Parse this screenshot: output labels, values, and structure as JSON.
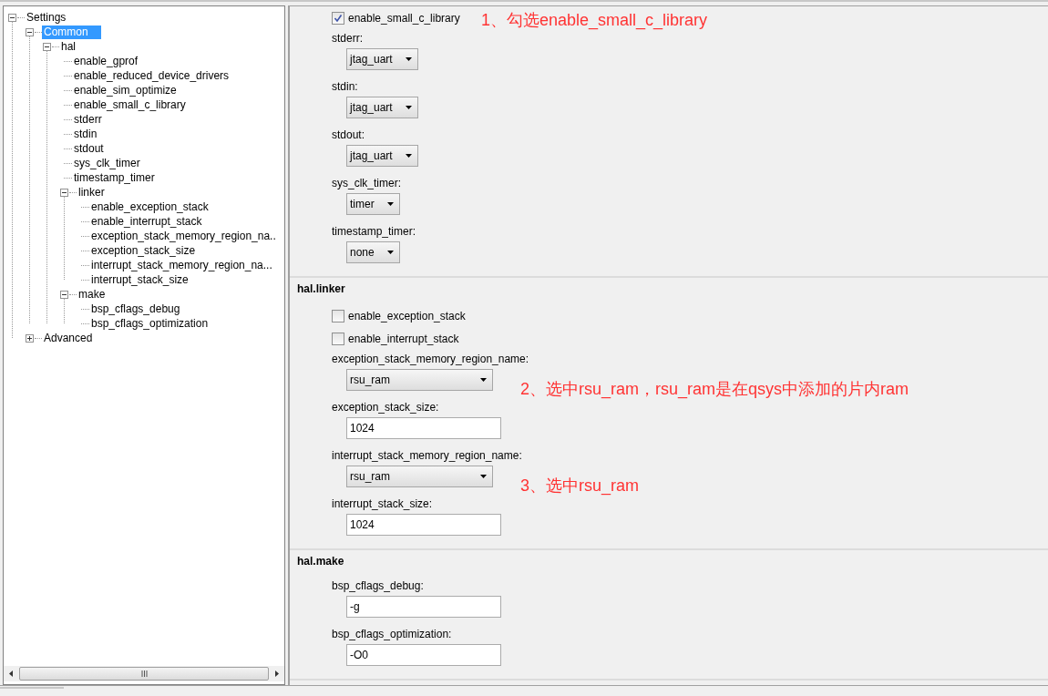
{
  "tree": [
    {
      "label": "Settings",
      "expanded": true,
      "selected": false,
      "children": [
        {
          "label": "Common",
          "expanded": true,
          "selected": true,
          "children": [
            {
              "label": "hal",
              "expanded": true,
              "selected": false,
              "children": [
                {
                  "label": "enable_gprof",
                  "selected": false
                },
                {
                  "label": "enable_reduced_device_drivers",
                  "selected": false
                },
                {
                  "label": "enable_sim_optimize",
                  "selected": false
                },
                {
                  "label": "enable_small_c_library",
                  "selected": false
                },
                {
                  "label": "stderr",
                  "selected": false
                },
                {
                  "label": "stdin",
                  "selected": false
                },
                {
                  "label": "stdout",
                  "selected": false
                },
                {
                  "label": "sys_clk_timer",
                  "selected": false
                },
                {
                  "label": "timestamp_timer",
                  "selected": false
                },
                {
                  "label": "linker",
                  "expanded": true,
                  "selected": false,
                  "children": [
                    {
                      "label": "enable_exception_stack",
                      "selected": false
                    },
                    {
                      "label": "enable_interrupt_stack",
                      "selected": false
                    },
                    {
                      "label": "exception_stack_memory_region_na..",
                      "selected": false
                    },
                    {
                      "label": "exception_stack_size",
                      "selected": false
                    },
                    {
                      "label": "interrupt_stack_memory_region_na...",
                      "selected": false
                    },
                    {
                      "label": "interrupt_stack_size",
                      "selected": false
                    }
                  ]
                },
                {
                  "label": "make",
                  "expanded": true,
                  "selected": false,
                  "children": [
                    {
                      "label": "bsp_cflags_debug",
                      "selected": false
                    },
                    {
                      "label": "bsp_cflags_optimization",
                      "selected": false
                    }
                  ]
                }
              ]
            }
          ]
        },
        {
          "label": "Advanced",
          "expanded": false,
          "selected": false
        }
      ]
    }
  ],
  "sections": [
    {
      "fields": [
        {
          "kind": "checkbox",
          "label": "enable_small_c_library",
          "checked": true,
          "note": "1、勾选enable_small_c_library"
        },
        {
          "kind": "select",
          "label": "stderr:",
          "value": "jtag_uart"
        },
        {
          "kind": "select",
          "label": "stdin:",
          "value": "jtag_uart"
        },
        {
          "kind": "select",
          "label": "stdout:",
          "value": "jtag_uart"
        },
        {
          "kind": "select",
          "label": "sys_clk_timer:",
          "value": "timer"
        },
        {
          "kind": "select",
          "label": "timestamp_timer:",
          "value": "none"
        }
      ]
    },
    {
      "title": "hal.linker",
      "fields": [
        {
          "kind": "checkbox",
          "label": "enable_exception_stack",
          "checked": false
        },
        {
          "kind": "checkbox",
          "label": "enable_interrupt_stack",
          "checked": false
        },
        {
          "kind": "select",
          "label": "exception_stack_memory_region_name:",
          "value": "rsu_ram",
          "note": "2、选中rsu_ram，rsu_ram是在qsys中添加的片内ram"
        },
        {
          "kind": "text",
          "label": "exception_stack_size:",
          "value": "1024"
        },
        {
          "kind": "select",
          "label": "interrupt_stack_memory_region_name:",
          "value": "rsu_ram",
          "note": "3、选中rsu_ram"
        },
        {
          "kind": "text",
          "label": "interrupt_stack_size:",
          "value": "1024"
        }
      ]
    },
    {
      "title": "hal.make",
      "fields": [
        {
          "kind": "text",
          "label": "bsp_cflags_debug:",
          "value": "-g"
        },
        {
          "kind": "text",
          "label": "bsp_cflags_optimization:",
          "value": "-O0"
        }
      ]
    }
  ]
}
